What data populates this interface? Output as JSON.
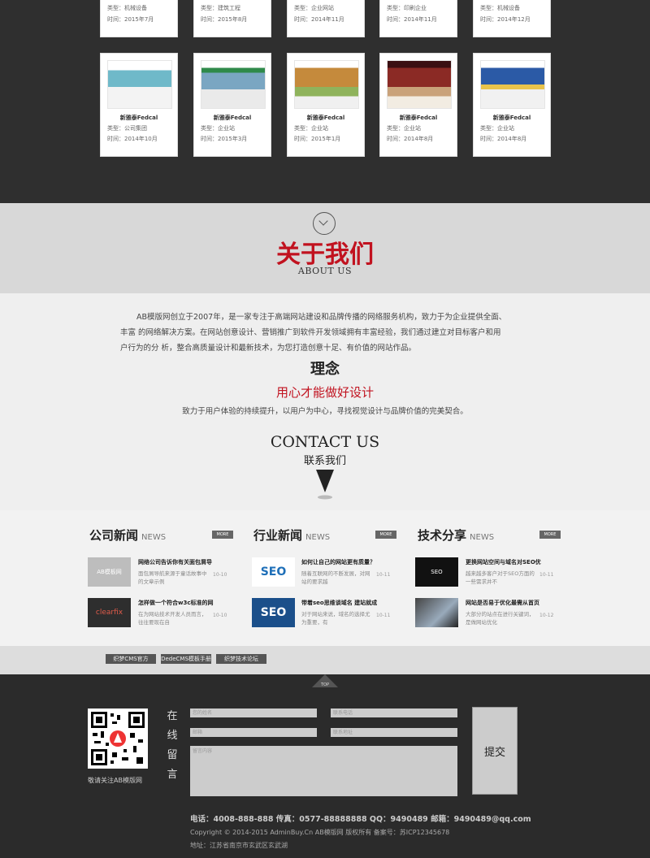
{
  "portfolio": {
    "top_cards": [
      {
        "type": "类型：机械设备",
        "time": "时间：2015年7月"
      },
      {
        "type": "类型：建筑工程",
        "time": "时间：2015年8月"
      },
      {
        "type": "类型：企业网站",
        "time": "时间：2014年11月"
      },
      {
        "type": "类型：印刷企业",
        "time": "时间：2014年11月"
      },
      {
        "type": "类型：机械设备",
        "time": "时间：2014年12月"
      }
    ],
    "bottom_cards": [
      {
        "title": "新雅泰Fedcal",
        "type": "类型：公司集团",
        "time": "时间：2014年10月"
      },
      {
        "title": "新雅泰Fedcal",
        "type": "类型：企业站",
        "time": "时间：2015年3月"
      },
      {
        "title": "新雅泰Fedcal",
        "type": "类型：企业站",
        "time": "时间：2015年1月"
      },
      {
        "title": "新雅泰Fedcal",
        "type": "类型：企业站",
        "time": "时间：2014年8月"
      },
      {
        "title": "新雅泰Fedcal",
        "type": "类型：企业站",
        "time": "时间：2014年8月"
      }
    ]
  },
  "about": {
    "title_cn": "关于我们",
    "title_en": "ABOUT US",
    "para1": "AB模版网创立于2007年，是一家专注于高端网站建设和品牌传播的网络服务机构，致力于为企业提供全面、",
    "para2": "丰富 的网络解决方案。在网站创意设计、营销推广到软件开发领域拥有丰富经验，我们通过建立对目标客户和用",
    "para3": "户行为的分 析，整合高质量设计和最新技术，为您打造创意十足、有价值的网站作品。",
    "concept": "理念",
    "slogan": "用心才能做好设计",
    "slogan_sub": "致力于用户体验的持续提升，以用户为中心，寻找视觉设计与品牌价值的完美契合。",
    "contact_en": "CONTACT US",
    "contact_cn": "联系我们"
  },
  "news": {
    "more_label": "MORE",
    "columns": [
      {
        "title": "公司新闻",
        "en": "NEWS",
        "items": [
          {
            "thumb": "AB模板网",
            "title": "网络公司告诉你有关面包屑导",
            "text": "面包屑导航来源于童话故事中的文章示例",
            "date": "10-10"
          },
          {
            "thumb": "clearfix",
            "title": "怎样做一个符合w3c标准的网",
            "text": "在为网站技术开发人员而言，往往要现在自",
            "date": "10-10"
          }
        ]
      },
      {
        "title": "行业新闻",
        "en": "NEWS",
        "items": [
          {
            "thumb": "SEO",
            "title": "如何让自己的网站更有质量？",
            "text": "随着互联网的不断发展，对网站的要求越",
            "date": "10-11"
          },
          {
            "thumb": "SEO",
            "title": "带着seo思维谈域名 建站就成",
            "text": "对于网站来说，域名的选择尤为重要，有",
            "date": "10-11"
          }
        ]
      },
      {
        "title": "技术分享",
        "en": "NEWS",
        "items": [
          {
            "thumb": "SEO",
            "title": "更换网站空间与域名对SEO优",
            "text": "越来越多客户对于SEO方面的一些需求并不",
            "date": "10-11"
          },
          {
            "thumb": "",
            "title": "网站是否易于优化最需从首页",
            "text": "大部分的站点在进行关键词，是做网站优化",
            "date": "10-12"
          }
        ]
      }
    ]
  },
  "links": [
    "织梦CMS官方",
    "DedeCMS模板手册",
    "织梦技术论坛"
  ],
  "footer": {
    "top_tab": "TOP",
    "qr_caption": "敬请关注AB模版网",
    "message_label": [
      "在",
      "线",
      "留",
      "言"
    ],
    "fields": {
      "name": "您的姓名",
      "phone": "联系电话",
      "email": "邮箱",
      "address": "联系地址",
      "content": "留言内容"
    },
    "submit_label": "提交",
    "contact_line": "电话：4008-888-888   传真：0577-88888888   QQ：9490489   邮箱：9490489@qq.com",
    "copyright": "Copyright © 2014-2015 AdminBuy.Cn AB模版网 版权所有 备案号：苏ICP12345678",
    "address": "地址：江苏省南京市玄武区玄武湖"
  },
  "colors": {
    "accent": "#c1121f",
    "dark": "#2f2f2f",
    "light": "#efefef"
  }
}
